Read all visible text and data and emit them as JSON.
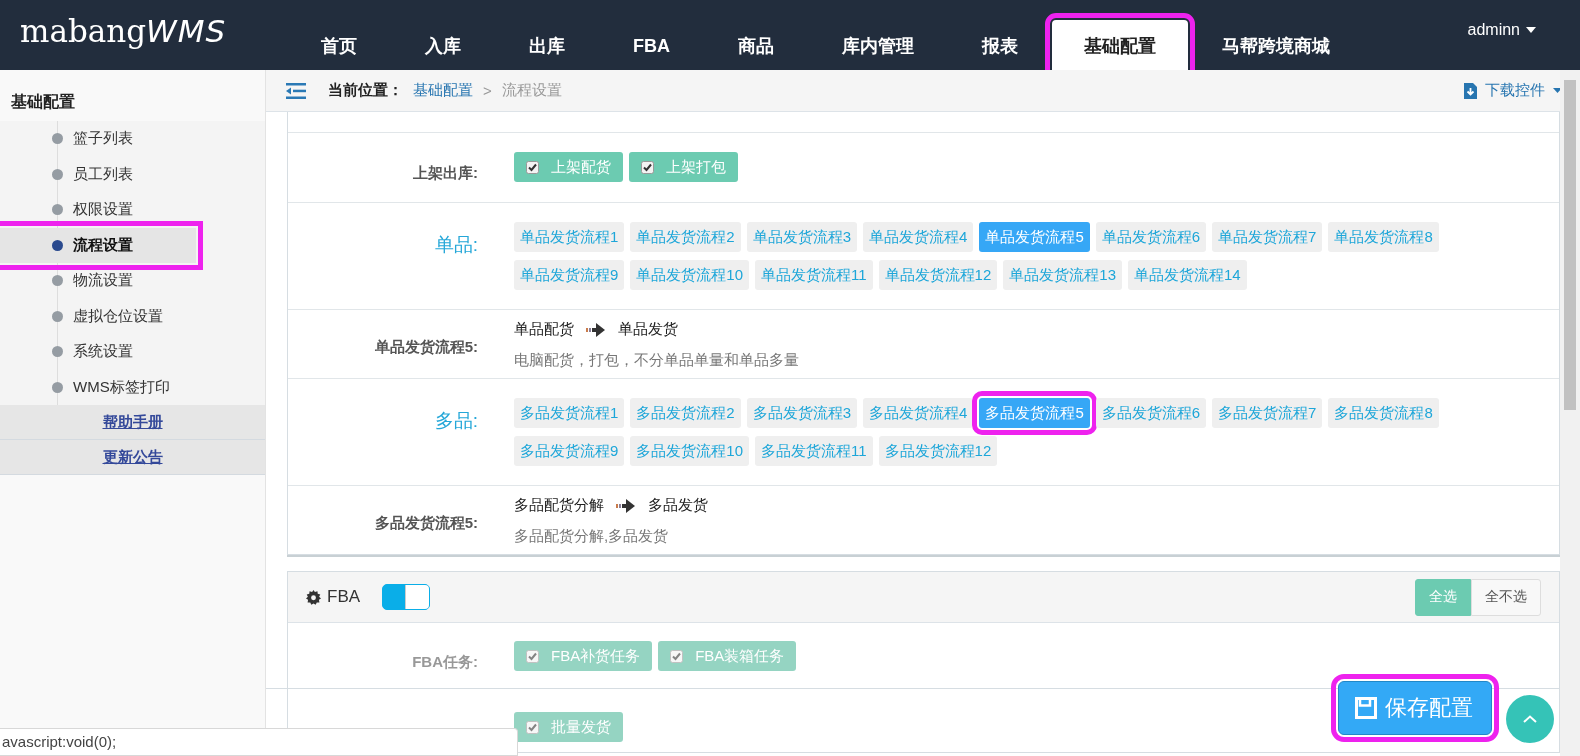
{
  "logo": {
    "text": "mabang",
    "suffix": "WMS"
  },
  "nav": [
    {
      "label": "首页",
      "selected": false,
      "highlighted": false
    },
    {
      "label": "入库",
      "selected": false,
      "highlighted": false
    },
    {
      "label": "出库",
      "selected": false,
      "highlighted": false
    },
    {
      "label": "FBA",
      "selected": false,
      "highlighted": false
    },
    {
      "label": "商品",
      "selected": false,
      "highlighted": false
    },
    {
      "label": "库内管理",
      "selected": false,
      "highlighted": false
    },
    {
      "label": "报表",
      "selected": false,
      "highlighted": false
    },
    {
      "label": "基础配置",
      "selected": true,
      "highlighted": true
    },
    {
      "label": "马帮跨境商城",
      "selected": false,
      "highlighted": false
    }
  ],
  "user": {
    "name": "adminn"
  },
  "sidebar": {
    "title": "基础配置",
    "items": [
      {
        "label": "篮子列表",
        "selected": false,
        "highlighted": false
      },
      {
        "label": "员工列表",
        "selected": false,
        "highlighted": false
      },
      {
        "label": "权限设置",
        "selected": false,
        "highlighted": false
      },
      {
        "label": "流程设置",
        "selected": true,
        "highlighted": true
      },
      {
        "label": "物流设置",
        "selected": false,
        "highlighted": false
      },
      {
        "label": "虚拟仓位设置",
        "selected": false,
        "highlighted": false
      },
      {
        "label": "系统设置",
        "selected": false,
        "highlighted": false
      },
      {
        "label": "WMS标签打印",
        "selected": false,
        "highlighted": false
      }
    ],
    "links": [
      "帮助手册",
      "更新公告"
    ]
  },
  "breadcrumb": {
    "prefix": "当前位置：",
    "items": [
      {
        "label": "基础配置",
        "kind": "link"
      },
      {
        "label": "流程设置",
        "kind": "current"
      }
    ],
    "separator": ">"
  },
  "download": {
    "label": "下载控件"
  },
  "flow_panel": {
    "rows": [
      {
        "kind": "checks",
        "label": "上架出库:",
        "options": [
          {
            "label": "上架配货",
            "checked": true
          },
          {
            "label": "上架打包",
            "checked": true
          }
        ]
      },
      {
        "kind": "pills",
        "label": "单品:",
        "options": [
          {
            "label": "单品发货流程1",
            "selected": false,
            "highlighted": false
          },
          {
            "label": "单品发货流程2",
            "selected": false,
            "highlighted": false
          },
          {
            "label": "单品发货流程3",
            "selected": false,
            "highlighted": false
          },
          {
            "label": "单品发货流程4",
            "selected": false,
            "highlighted": false
          },
          {
            "label": "单品发货流程5",
            "selected": true,
            "highlighted": false
          },
          {
            "label": "单品发货流程6",
            "selected": false,
            "highlighted": false
          },
          {
            "label": "单品发货流程7",
            "selected": false,
            "highlighted": false
          },
          {
            "label": "单品发货流程8",
            "selected": false,
            "highlighted": false
          },
          {
            "label": "单品发货流程9",
            "selected": false,
            "highlighted": false
          },
          {
            "label": "单品发货流程10",
            "selected": false,
            "highlighted": false
          },
          {
            "label": "单品发货流程11",
            "selected": false,
            "highlighted": false
          },
          {
            "label": "单品发货流程12",
            "selected": false,
            "highlighted": false
          },
          {
            "label": "单品发货流程13",
            "selected": false,
            "highlighted": false
          },
          {
            "label": "单品发货流程14",
            "selected": false,
            "highlighted": false
          }
        ]
      },
      {
        "kind": "flow",
        "label": "单品发货流程5:",
        "steps": [
          "单品配货",
          "单品发货"
        ],
        "description": "电脑配货，打包，不分单品单量和单品多量"
      },
      {
        "kind": "pills",
        "label": "多品:",
        "options": [
          {
            "label": "多品发货流程1",
            "selected": false,
            "highlighted": false
          },
          {
            "label": "多品发货流程2",
            "selected": false,
            "highlighted": false
          },
          {
            "label": "多品发货流程3",
            "selected": false,
            "highlighted": false
          },
          {
            "label": "多品发货流程4",
            "selected": false,
            "highlighted": false
          },
          {
            "label": "多品发货流程5",
            "selected": true,
            "highlighted": true
          },
          {
            "label": "多品发货流程6",
            "selected": false,
            "highlighted": false
          },
          {
            "label": "多品发货流程7",
            "selected": false,
            "highlighted": false
          },
          {
            "label": "多品发货流程8",
            "selected": false,
            "highlighted": false
          },
          {
            "label": "多品发货流程9",
            "selected": false,
            "highlighted": false
          },
          {
            "label": "多品发货流程10",
            "selected": false,
            "highlighted": false
          },
          {
            "label": "多品发货流程11",
            "selected": false,
            "highlighted": false
          },
          {
            "label": "多品发货流程12",
            "selected": false,
            "highlighted": false
          }
        ]
      },
      {
        "kind": "flow",
        "label": "多品发货流程5:",
        "steps": [
          "多品配货分解",
          "多品发货"
        ],
        "description": "多品配货分解,多品发货"
      }
    ]
  },
  "fba_panel": {
    "title": "FBA",
    "enabled": true,
    "dimmed": true,
    "buttons": [
      {
        "label": "全选",
        "selected": true
      },
      {
        "label": "全不选",
        "selected": false
      }
    ],
    "rows": [
      {
        "kind": "checks",
        "label": "FBA任务:",
        "options": [
          {
            "label": "FBA补货任务",
            "checked": true
          },
          {
            "label": "FBA装箱任务",
            "checked": true
          }
        ]
      },
      {
        "kind": "checks",
        "options": [
          {
            "label": "批量发货",
            "checked": true
          }
        ]
      }
    ]
  },
  "save_button": {
    "label": "保存配置",
    "highlighted": true
  },
  "status_bar": {
    "text": "avascript:void(0);"
  }
}
